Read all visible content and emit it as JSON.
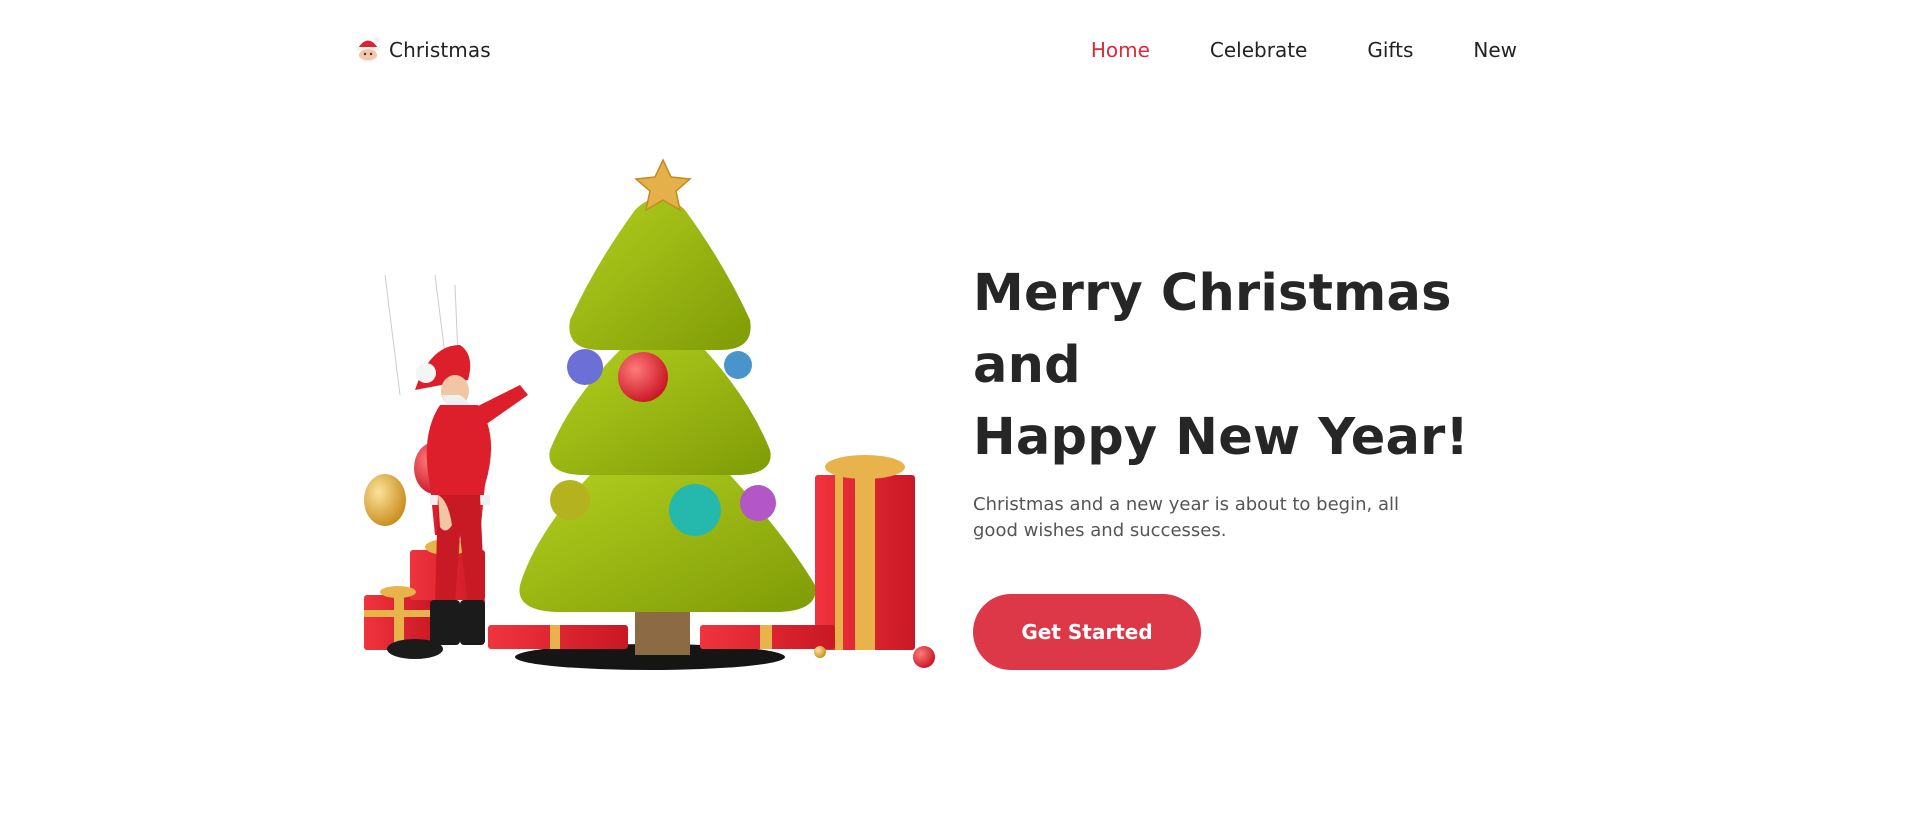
{
  "brand": {
    "name": "Christmas",
    "icon": "santa-face-icon"
  },
  "nav": {
    "items": [
      {
        "label": "Home",
        "active": true
      },
      {
        "label": "Celebrate",
        "active": false
      },
      {
        "label": "Gifts",
        "active": false
      },
      {
        "label": "New",
        "active": false
      }
    ]
  },
  "hero": {
    "title_line1": "Merry Christmas and",
    "title_line2": "Happy New Year!",
    "description": "Christmas and a new year is about to begin, all good wishes and successes.",
    "cta_label": "Get Started",
    "illustration": "christmas-tree-santa-gifts-illustration"
  },
  "colors": {
    "accent": "#dc3847",
    "active_nav": "#d92b3a",
    "text": "#262626",
    "tree_green": "#9bbc0c",
    "gift_red": "#e8232f",
    "ribbon_gold": "#e8b34a"
  }
}
